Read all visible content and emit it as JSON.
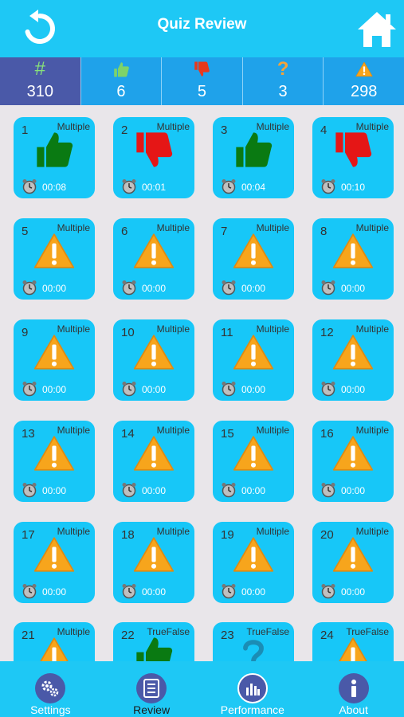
{
  "header": {
    "title": "Quiz Review"
  },
  "stats": [
    {
      "icon": "hash-icon",
      "glyph": "#",
      "value": "310"
    },
    {
      "icon": "thumbs-up-icon",
      "value": "6"
    },
    {
      "icon": "thumbs-down-icon",
      "value": "5"
    },
    {
      "icon": "question-mark-icon",
      "glyph": "?",
      "value": "3"
    },
    {
      "icon": "warning-icon",
      "value": "298"
    }
  ],
  "questions": [
    {
      "number": "1",
      "type": "Multiple",
      "status": "correct",
      "time": "00:08"
    },
    {
      "number": "2",
      "type": "Multiple",
      "status": "wrong",
      "time": "00:01"
    },
    {
      "number": "3",
      "type": "Multiple",
      "status": "correct",
      "time": "00:04"
    },
    {
      "number": "4",
      "type": "Multiple",
      "status": "wrong",
      "time": "00:10"
    },
    {
      "number": "5",
      "type": "Multiple",
      "status": "unanswered",
      "time": "00:00"
    },
    {
      "number": "6",
      "type": "Multiple",
      "status": "unanswered",
      "time": "00:00"
    },
    {
      "number": "7",
      "type": "Multiple",
      "status": "unanswered",
      "time": "00:00"
    },
    {
      "number": "8",
      "type": "Multiple",
      "status": "unanswered",
      "time": "00:00"
    },
    {
      "number": "9",
      "type": "Multiple",
      "status": "unanswered",
      "time": "00:00"
    },
    {
      "number": "10",
      "type": "Multiple",
      "status": "unanswered",
      "time": "00:00"
    },
    {
      "number": "11",
      "type": "Multiple",
      "status": "unanswered",
      "time": "00:00"
    },
    {
      "number": "12",
      "type": "Multiple",
      "status": "unanswered",
      "time": "00:00"
    },
    {
      "number": "13",
      "type": "Multiple",
      "status": "unanswered",
      "time": "00:00"
    },
    {
      "number": "14",
      "type": "Multiple",
      "status": "unanswered",
      "time": "00:00"
    },
    {
      "number": "15",
      "type": "Multiple",
      "status": "unanswered",
      "time": "00:00"
    },
    {
      "number": "16",
      "type": "Multiple",
      "status": "unanswered",
      "time": "00:00"
    },
    {
      "number": "17",
      "type": "Multiple",
      "status": "unanswered",
      "time": "00:00"
    },
    {
      "number": "18",
      "type": "Multiple",
      "status": "unanswered",
      "time": "00:00"
    },
    {
      "number": "19",
      "type": "Multiple",
      "status": "unanswered",
      "time": "00:00"
    },
    {
      "number": "20",
      "type": "Multiple",
      "status": "unanswered",
      "time": "00:00"
    },
    {
      "number": "21",
      "type": "Multiple",
      "status": "unanswered",
      "time": ""
    },
    {
      "number": "22",
      "type": "TrueFalse",
      "status": "correct",
      "time": ""
    },
    {
      "number": "23",
      "type": "TrueFalse",
      "status": "skipped",
      "time": ""
    },
    {
      "number": "24",
      "type": "TrueFalse",
      "status": "unanswered",
      "time": ""
    }
  ],
  "tabs": [
    {
      "label": "Settings",
      "icon": "gear-icon",
      "active": false
    },
    {
      "label": "Review",
      "icon": "list-icon",
      "active": true
    },
    {
      "label": "Performance",
      "icon": "bar-chart-icon",
      "active": false
    },
    {
      "label": "About",
      "icon": "info-icon",
      "active": false
    }
  ],
  "colors": {
    "header": "#1ec8f5",
    "tile": "#17c7f8",
    "accent": "#4a59a8",
    "correct": "#0a7a12",
    "wrong": "#e51616",
    "warning": "#f7a51c"
  }
}
